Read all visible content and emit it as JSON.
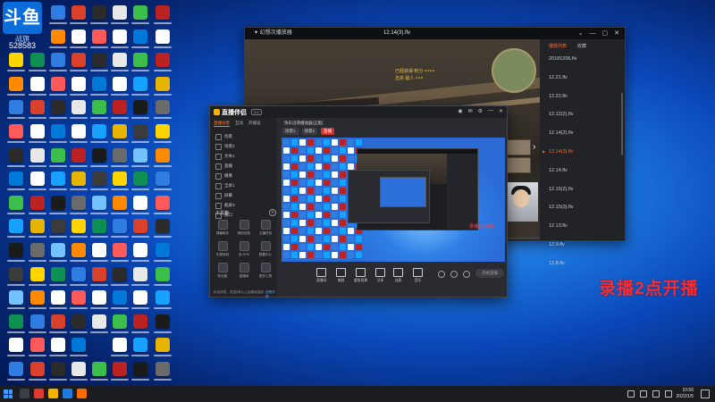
{
  "desktop": {
    "logo_text": "斗鱼",
    "logo_sub": "战旗",
    "room_number": "528583",
    "overlay_text": "录播2点开播",
    "icon_colors": [
      "#2f7de1",
      "#e8e8e8",
      "#1b1b1b",
      "#ff8a00",
      "#ffffff",
      "#17a2ff",
      "#ffd500",
      "#d9412a",
      "#3cbf4a",
      "#6a6a6a",
      "#ffffff",
      "#0078d7",
      "#e7b400",
      "#0e8f53",
      "#2b2b2b",
      "#bb2222",
      "#73c2fb",
      "#ff5a5a",
      "#ffffff",
      "#3b3b3b"
    ]
  },
  "player": {
    "title_left": "✦ 幻想次播放器",
    "title_center": "12.14(3).flv",
    "controls": [
      "⌄",
      "—",
      "▢",
      "✕"
    ],
    "hud_lines": [
      "已经获得 积分 ××××",
      "击杀 敌人 ×××"
    ],
    "playlist_tabs": {
      "active": "播放列表",
      "inactive": "收藏"
    },
    "playlist": [
      "20181206.flv",
      "12.21.flv",
      "12.22.flv",
      "12.12(2).flv",
      "12.14(2).flv",
      "12.14(3).flv",
      "12.14.flv",
      "12.15(2).flv",
      "12.15(3).flv",
      "12.13.flv",
      "12.9.flv",
      "12.8.flv"
    ],
    "current_index": 5
  },
  "recorder": {
    "brand": "直播伴侣",
    "version": "3.0",
    "tabs_left": [
      "直播场景",
      "互动",
      "开播设"
    ],
    "scenes": [
      "场景",
      "场景2",
      "文本1",
      "直播",
      "摄像",
      "全屏1",
      "屏幕",
      "截屏3",
      "窗口"
    ],
    "toolbox_title": "工具箱",
    "tools": [
      "弹幕助手",
      "精彩回放",
      "主播任务",
      "礼物特效",
      "多人PK",
      "数据中心",
      "粉丝团",
      "直播间",
      "更多工具"
    ],
    "preview_tabs": [
      "场景1",
      "场景2",
      "直播"
    ],
    "preview_title": "快乐迅哥播放器(正版)",
    "preview_label": "录播2点开播",
    "buttons": [
      "直播间",
      "美颜",
      "虚拟背景",
      "分享",
      "连麦",
      "音乐"
    ],
    "start_label": "开始直播",
    "bottom_note": "私信消息，发送5条以上后解锁连接",
    "bottom_link": "查看详情"
  },
  "taskbar": {
    "time": "10:56",
    "date": "2022/1/5"
  }
}
